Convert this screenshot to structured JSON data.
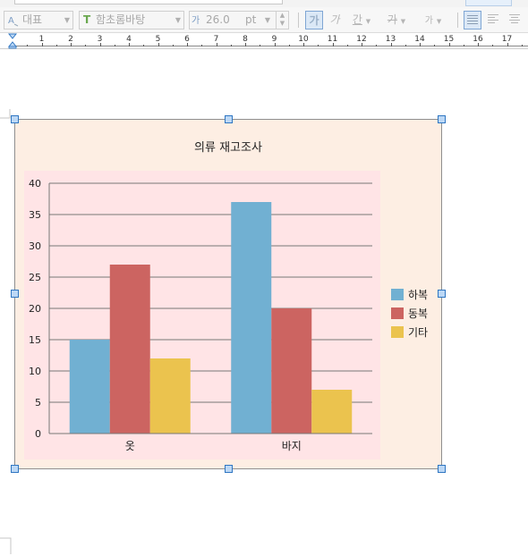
{
  "toolbar": {
    "style_value": "대표",
    "font_value": "함초롬바탕",
    "size_value": "26.0",
    "size_unit": "pt",
    "bold_glyph": "가",
    "italic_glyph": "가",
    "underline_glyph": "간",
    "strike_glyph": "가",
    "super_glyph": "가",
    "font_icon_glyph": "T"
  },
  "ruler": {
    "numbers": [
      "1",
      "2",
      "3",
      "4",
      "5",
      "6",
      "7",
      "8",
      "9",
      "10",
      "11",
      "12",
      "13",
      "14",
      "15",
      "16",
      "17"
    ]
  },
  "colors": {
    "series_summer": "#71b0d2",
    "series_winter": "#cc6461",
    "series_other": "#ebc34e",
    "plot_bg": "#ffe4e6",
    "chart_bg": "#fdeee3"
  },
  "chart_data": {
    "type": "bar",
    "title": "의류 재고조사",
    "categories": [
      "옷",
      "바지"
    ],
    "series": [
      {
        "name": "하복",
        "values": [
          15,
          37
        ]
      },
      {
        "name": "동복",
        "values": [
          27,
          20
        ]
      },
      {
        "name": "기타",
        "values": [
          12,
          7
        ]
      }
    ],
    "ylim": [
      0,
      40
    ],
    "yticks": [
      0,
      5,
      10,
      15,
      20,
      25,
      30,
      35,
      40
    ],
    "grid": true,
    "legend": "right"
  }
}
